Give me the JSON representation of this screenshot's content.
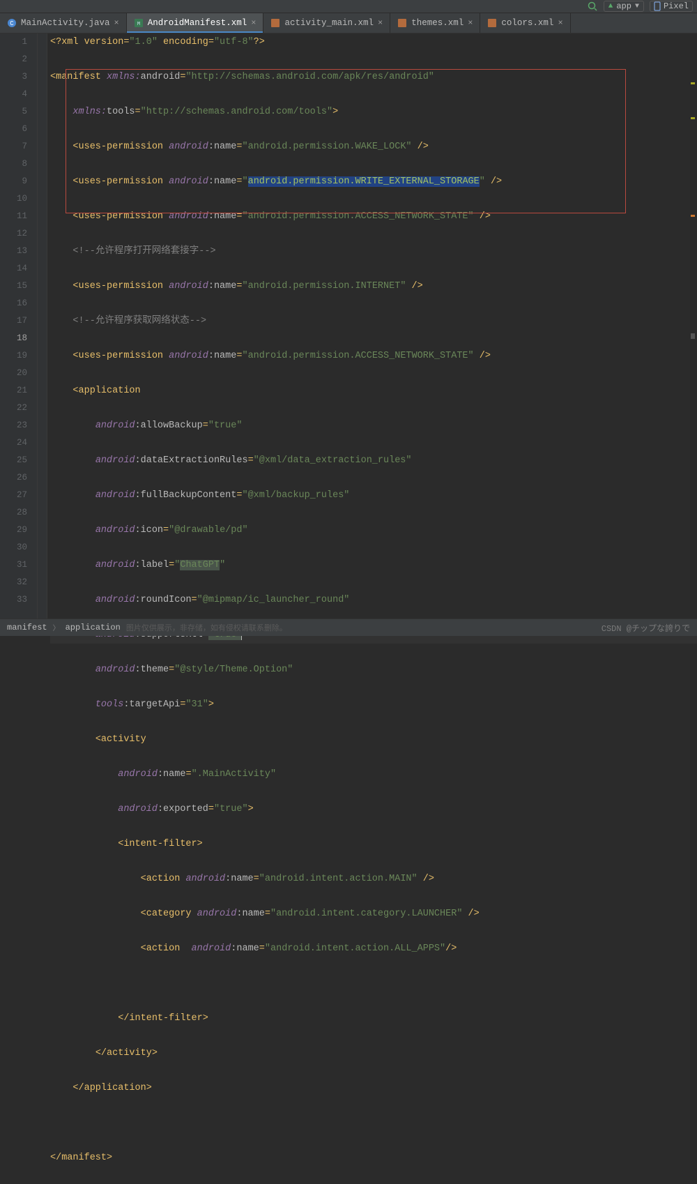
{
  "topbar": {
    "run_config": "app",
    "device_btn": "Pixel"
  },
  "tabs": [
    {
      "label": "MainActivity.java",
      "icon": "java-class-icon",
      "active": false
    },
    {
      "label": "AndroidManifest.xml",
      "icon": "manifest-icon",
      "active": true
    },
    {
      "label": "activity_main.xml",
      "icon": "layout-xml-icon",
      "active": false
    },
    {
      "label": "themes.xml",
      "icon": "xml-icon",
      "active": false
    },
    {
      "label": "colors.xml",
      "icon": "xml-icon",
      "active": false
    }
  ],
  "lines": {
    "l1": {
      "prolog": "<?xml version=",
      "ver": "\"1.0\"",
      "enc_k": " encoding=",
      "enc": "\"utf-8\"",
      "end": "?>"
    },
    "l2": {
      "open": "<manifest ",
      "ns1": "xmlns:",
      "nsk1": "android",
      "eq1": "=",
      "v1": "\"http://schemas.android.com/apk/res/android\""
    },
    "l3": {
      "ns": "xmlns:",
      "nsk": "tools",
      "eq": "=",
      "v": "\"http://schemas.android.com/tools\"",
      "close": ">"
    },
    "l4": {
      "tag": "<uses-permission ",
      "ns": "android",
      "attr": ":name",
      "eq": "=",
      "v": "\"android.permission.WAKE_LOCK\"",
      "end": " />"
    },
    "l5": {
      "tag": "<uses-permission ",
      "ns": "android",
      "attr": ":name",
      "eq": "=",
      "vq": "\"",
      "v": "android.permission.WRITE_EXTERNAL_STORAGE",
      "vq2": "\"",
      "end": " />"
    },
    "l6": {
      "tag": "<uses-permission ",
      "ns": "android",
      "attr": ":name",
      "eq": "=",
      "v": "\"android.permission.ACCESS_NETWORK_STATE\"",
      "end": " />"
    },
    "l7": {
      "comm": "<!--允许程序打开网络套接字-->"
    },
    "l8": {
      "tag": "<uses-permission ",
      "ns": "android",
      "attr": ":name",
      "eq": "=",
      "v": "\"android.permission.INTERNET\"",
      "end": " />"
    },
    "l9": {
      "comm": "<!--允许程序获取网络状态-->"
    },
    "l10": {
      "tag": "<uses-permission ",
      "ns": "android",
      "attr": ":name",
      "eq": "=",
      "v": "\"android.permission.ACCESS_NETWORK_STATE\"",
      "end": " />"
    },
    "l11": {
      "tag": "<application"
    },
    "l12": {
      "ns": "android",
      "attr": ":allowBackup",
      "eq": "=",
      "v": "\"true\""
    },
    "l13": {
      "ns": "android",
      "attr": ":dataExtractionRules",
      "eq": "=",
      "v": "\"@xml/data_extraction_rules\""
    },
    "l14": {
      "ns": "android",
      "attr": ":fullBackupContent",
      "eq": "=",
      "v": "\"@xml/backup_rules\""
    },
    "l15": {
      "ns": "android",
      "attr": ":icon",
      "eq": "=",
      "v": "\"@drawable/pd\""
    },
    "l16": {
      "ns": "android",
      "attr": ":label",
      "eq": "=",
      "vq": "\"",
      "v": "ChatGPT",
      "vq2": "\""
    },
    "l17": {
      "ns": "android",
      "attr": ":roundIcon",
      "eq": "=",
      "v": "\"@mipmap/ic_launcher_round\""
    },
    "l18": {
      "ns": "android",
      "attr": ":supportsRtl",
      "eq": "=",
      "vq": "\"",
      "v": "true",
      "vq2": "\""
    },
    "l19": {
      "ns": "android",
      "attr": ":theme",
      "eq": "=",
      "v": "\"@style/Theme.Option\""
    },
    "l20": {
      "ns": "tools",
      "attr": ":targetApi",
      "eq": "=",
      "v": "\"31\"",
      "close": ">"
    },
    "l21": {
      "tag": "<activity"
    },
    "l22": {
      "ns": "android",
      "attr": ":name",
      "eq": "=",
      "v": "\".MainActivity\""
    },
    "l23": {
      "ns": "android",
      "attr": ":exported",
      "eq": "=",
      "v": "\"true\"",
      "close": ">"
    },
    "l24": {
      "tag": "<intent-filter>"
    },
    "l25": {
      "tag": "<action ",
      "ns": "android",
      "attr": ":name",
      "eq": "=",
      "v": "\"android.intent.action.MAIN\"",
      "end": " />"
    },
    "l26": {
      "tag": "<category ",
      "ns": "android",
      "attr": ":name",
      "eq": "=",
      "v": "\"android.intent.category.LAUNCHER\"",
      "end": " />"
    },
    "l27": {
      "tag": "<action  ",
      "ns": "android",
      "attr": ":name",
      "eq": "=",
      "v": "\"android.intent.action.ALL_APPS\"",
      "end": "/>"
    },
    "l29": {
      "tag": "</intent-filter>"
    },
    "l30": {
      "tag": "</activity>"
    },
    "l31": {
      "tag": "</application>"
    },
    "l33": {
      "tag": "</manifest>"
    }
  },
  "line_numbers": [
    "1",
    "2",
    "3",
    "4",
    "5",
    "6",
    "7",
    "8",
    "9",
    "10",
    "11",
    "12",
    "13",
    "14",
    "15",
    "16",
    "17",
    "18",
    "19",
    "20",
    "21",
    "22",
    "23",
    "24",
    "25",
    "26",
    "27",
    "28",
    "29",
    "30",
    "31",
    "32",
    "33"
  ],
  "breadcrumb": {
    "a": "manifest",
    "b": "application"
  },
  "status_faded": "图片仅供展示，非存储，如有侵权请联系删除。",
  "watermark": "CSDN @チップな誇りで"
}
